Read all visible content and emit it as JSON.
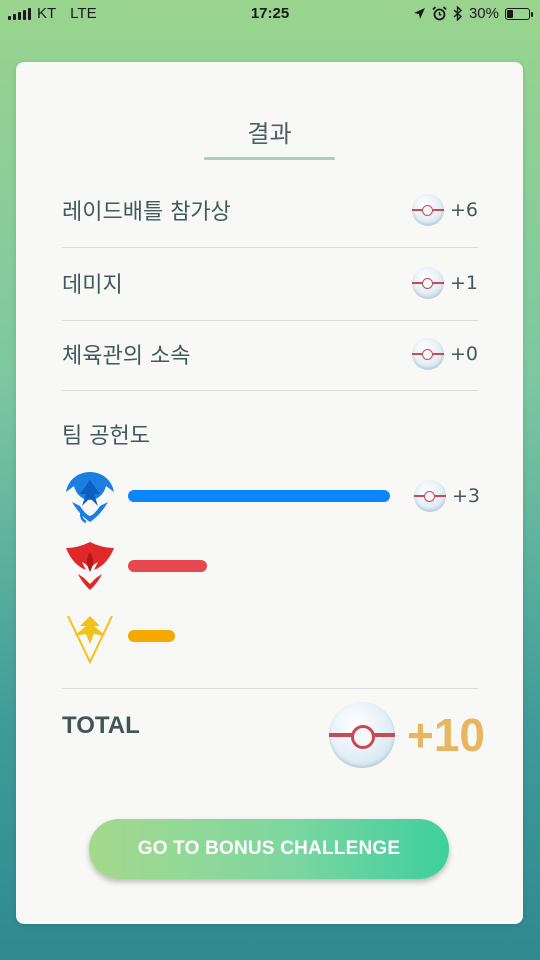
{
  "status_bar": {
    "carrier": "KT",
    "network": "LTE",
    "time": "17:25",
    "battery": "30%",
    "battery_level": 0.3
  },
  "results": {
    "title": "결과",
    "rows": [
      {
        "label": "레이드배틀 참가상",
        "value": "+6",
        "icon": "premier-ball-icon"
      },
      {
        "label": "데미지",
        "value": "+1",
        "icon": "premier-ball-icon"
      },
      {
        "label": "체육관의 소속",
        "value": "+0",
        "icon": "premier-ball-icon"
      }
    ],
    "team_section": {
      "title": "팀 공헌도",
      "teams": [
        {
          "name": "mystic",
          "icon": "team-mystic-icon",
          "color": "#0a84ff",
          "bar_fraction": 1.0,
          "value": "+3"
        },
        {
          "name": "valor",
          "icon": "team-valor-icon",
          "color": "#e5484d",
          "bar_fraction": 0.3
        },
        {
          "name": "instinct",
          "icon": "team-instinct-icon",
          "color": "#f5a800",
          "bar_fraction": 0.18
        }
      ]
    },
    "total": {
      "label": "TOTAL",
      "value": "+10"
    }
  },
  "bonus_button": {
    "label": "GO TO BONUS CHALLENGE"
  },
  "colors": {
    "accent_total": "#e8b560",
    "button_start": "#a5d98d",
    "button_end": "#3ecf9f"
  }
}
